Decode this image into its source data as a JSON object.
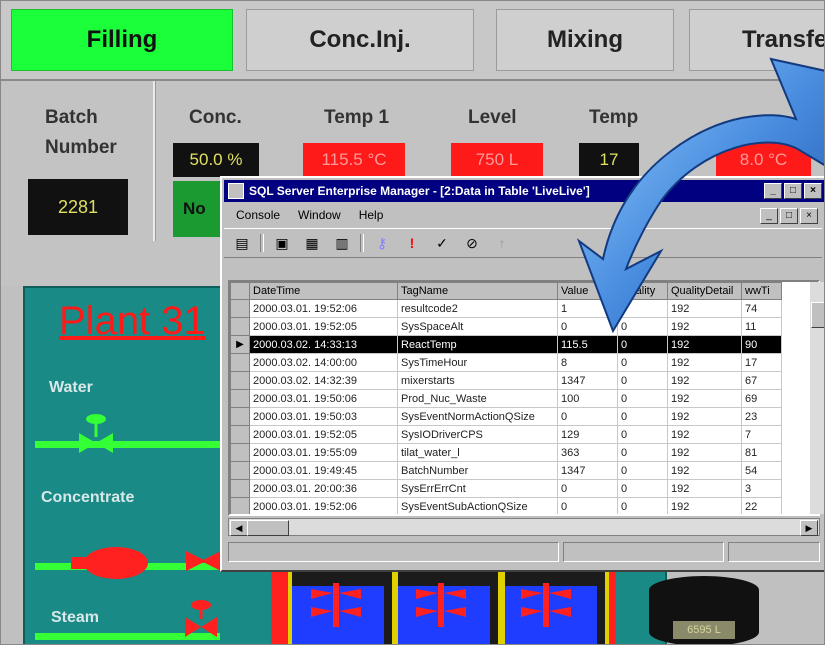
{
  "tabs": [
    "Filling",
    "Conc.Inj.",
    "Mixing",
    "Transfer"
  ],
  "status": {
    "batch_label_1": "Batch",
    "batch_label_2": "Number",
    "batch_number": "2281",
    "conc_label": "Conc.",
    "conc_value": "50.0 %",
    "temp1_label": "Temp 1",
    "temp1_value": "115.5 °C",
    "level_label": "Level",
    "level_value": "750 L",
    "temp2_label": "Temp",
    "temp2_value_partial": "17",
    "temp3_value": "8.0 °C",
    "indicator_partial": "No"
  },
  "plant": {
    "title": "Plant 31",
    "water_label": "Water",
    "concentrate_label": "Concentrate",
    "steam_label": "Steam",
    "tank_readout": "6595 L"
  },
  "window": {
    "title": "SQL Server Enterprise Manager - [2:Data in Table 'LiveLive']",
    "menus": [
      "Console",
      "Window",
      "Help"
    ],
    "columns": [
      "DateTime",
      "TagName",
      "Value",
      "Quality",
      "QualityDetail",
      "wwTi"
    ],
    "rows": [
      [
        "2000.03.01. 19:52:06",
        "resultcode2",
        "1",
        "0",
        "192",
        "74"
      ],
      [
        "2000.03.01. 19:52:05",
        "SysSpaceAlt",
        "0",
        "0",
        "192",
        "11"
      ],
      [
        "2000.03.02. 14:33:13",
        "ReactTemp",
        "115.5",
        "0",
        "192",
        "90"
      ],
      [
        "2000.03.02. 14:00:00",
        "SysTimeHour",
        "8",
        "0",
        "192",
        "17"
      ],
      [
        "2000.03.02. 14:32:39",
        "mixerstarts",
        "1347",
        "0",
        "192",
        "67"
      ],
      [
        "2000.03.01. 19:50:06",
        "Prod_Nuc_Waste",
        "100",
        "0",
        "192",
        "69"
      ],
      [
        "2000.03.01. 19:50:03",
        "SysEventNormActionQSize",
        "0",
        "0",
        "192",
        "23"
      ],
      [
        "2000.03.01. 19:52:05",
        "SysIODriverCPS",
        "129",
        "0",
        "192",
        "7"
      ],
      [
        "2000.03.01. 19:55:09",
        "tilat_water_l",
        "363",
        "0",
        "192",
        "81"
      ],
      [
        "2000.03.01. 19:49:45",
        "BatchNumber",
        "1347",
        "0",
        "192",
        "54"
      ],
      [
        "2000.03.01. 20:00:36",
        "SysErrErrCnt",
        "0",
        "0",
        "192",
        "3"
      ],
      [
        "2000.03.01. 19:52:06",
        "SysEventSubActionQSize",
        "0",
        "0",
        "192",
        "22"
      ]
    ],
    "selected_row_marker": "▶"
  },
  "colors": {
    "active_tab": "#1aff3a",
    "alarm_red": "#ff1a1a",
    "plant_teal": "#1a8a86",
    "pipe_green": "#35ff35",
    "title_blue": "#000080"
  },
  "icons": [
    "window-app-icon",
    "minimize-icon",
    "maximize-icon",
    "close-icon",
    "curved-arrow-icon"
  ]
}
